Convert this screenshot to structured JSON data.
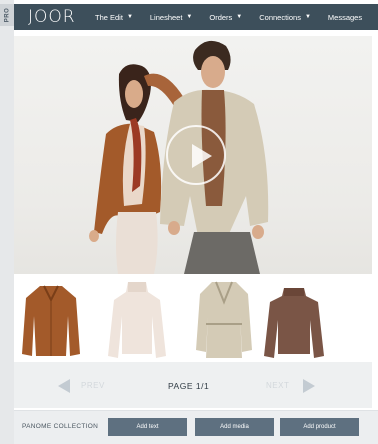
{
  "badge": {
    "label": "PRO"
  },
  "nav": {
    "logo": "JOOR",
    "items": [
      {
        "label": "The Edit"
      },
      {
        "label": "Linesheet"
      },
      {
        "label": "Orders"
      },
      {
        "label": "Connections"
      },
      {
        "label": "Messages"
      }
    ]
  },
  "hero": {
    "play_icon": "play-icon"
  },
  "products": [
    {
      "name": "brown leather jacket",
      "color": "#a35a2a"
    },
    {
      "name": "cream turtleneck",
      "color": "#efe4dc"
    },
    {
      "name": "beige trench coat",
      "color": "#d4cbb6"
    },
    {
      "name": "brown turtleneck sweater",
      "color": "#7a5546"
    }
  ],
  "pager": {
    "prev": "PREV",
    "page": "PAGE 1/1",
    "next": "NEXT"
  },
  "bottombar": {
    "collection": "PANOME COLLECTION",
    "add_text": "Add text",
    "add_media": "Add media",
    "add_product": "Add product"
  },
  "colors": {
    "nav_bg": "#3d4f5b",
    "button_bg": "#5e7080",
    "pager_bg": "#eef0f1"
  }
}
